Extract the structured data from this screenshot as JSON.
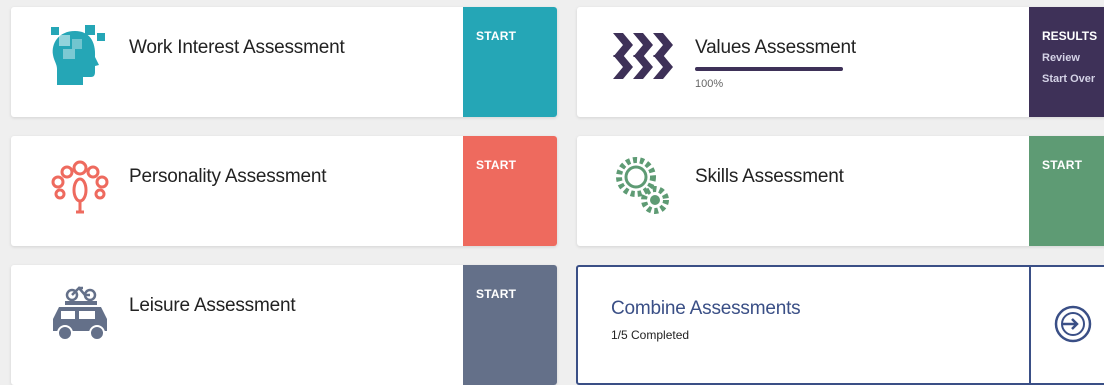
{
  "cards": {
    "work_interest": {
      "title": "Work Interest Assessment",
      "action": "START"
    },
    "values": {
      "title": "Values Assessment",
      "progress_value": 100,
      "progress_text": "100%",
      "results_label": "RESULTS",
      "review_label": "Review",
      "start_over_label": "Start Over"
    },
    "personality": {
      "title": "Personality Assessment",
      "action": "START"
    },
    "skills": {
      "title": "Skills Assessment",
      "action": "START"
    },
    "leisure": {
      "title": "Leisure Assessment",
      "action": "START"
    }
  },
  "combine": {
    "title": "Combine Assessments",
    "status": "1/5 Completed"
  },
  "colors": {
    "work_interest": "#25a6b6",
    "values": "#3e3158",
    "personality": "#ee6a5e",
    "skills": "#5e9b74",
    "leisure": "#647089",
    "combine_border": "#3a4f86"
  },
  "icons": {
    "work_interest": "head-puzzle-icon",
    "values": "chevrons-icon",
    "personality": "peacock-icon",
    "skills": "gears-icon",
    "leisure": "car-bike-icon",
    "combine": "sign-in-circle-icon"
  }
}
